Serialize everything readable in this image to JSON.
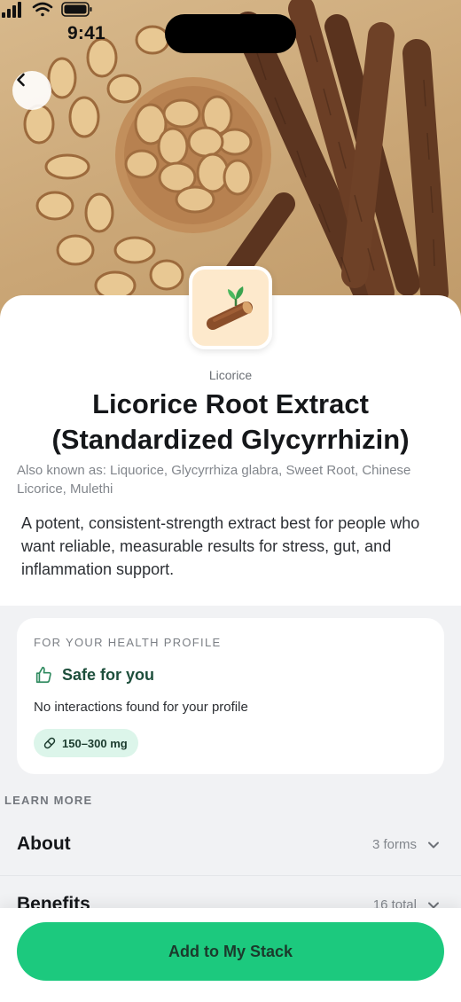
{
  "status_bar": {
    "time": "9:41"
  },
  "product": {
    "category": "Licorice",
    "title": "Licorice Root Extract (Standardized Glycyrrhizin)",
    "also_known_as": "Also known as: Liquorice, Glycyrrhiza glabra, Sweet Root, Chinese Licorice, Mulethi",
    "description": "A potent, consistent-strength extract best for people who want reliable, measurable results for stress, gut, and inflammation support."
  },
  "health_profile": {
    "kicker": "FOR YOUR HEALTH PROFILE",
    "status": "Safe for you",
    "interactions": "No interactions found for your profile",
    "dose": "150–300 mg"
  },
  "learn_more": {
    "label": "LEARN MORE",
    "sections": [
      {
        "title": "About",
        "meta": "3 forms"
      },
      {
        "title": "Benefits",
        "meta": "16 total"
      }
    ]
  },
  "cta": {
    "label": "Add to My Stack"
  },
  "colors": {
    "accent": "#1cc97e",
    "safe_text": "#1e4f3c",
    "pill_bg": "#dcf5ea",
    "icon_bg": "#fde9cc"
  },
  "icons": [
    "back-chevron-icon",
    "licorice-root-icon",
    "thumbs-up-icon",
    "pill-icon",
    "chevron-down-icon"
  ]
}
